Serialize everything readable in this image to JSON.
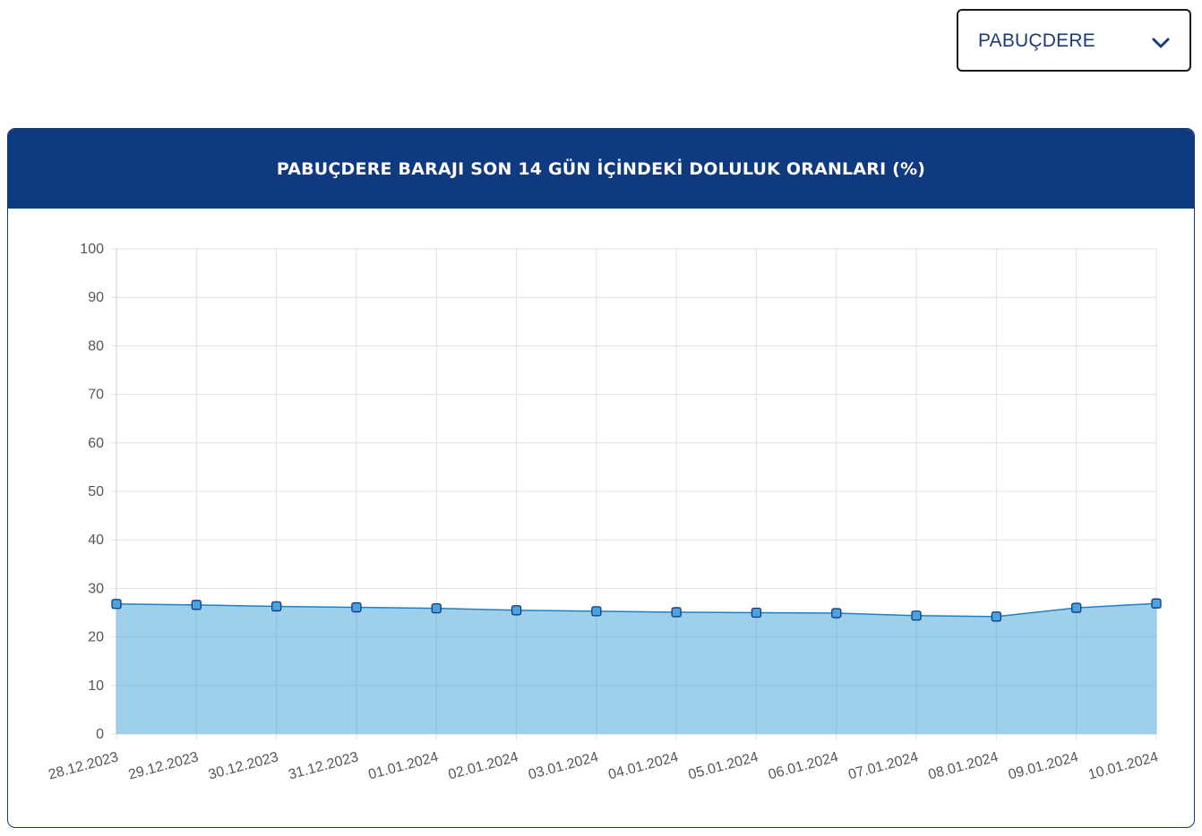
{
  "dropdown": {
    "selected": "PABUÇDERE",
    "icon": "chevron-down-icon"
  },
  "colors": {
    "header": "#0f3a80",
    "fill": "#99cdeb",
    "line": "#1f80c8",
    "marker": "#4aa3df",
    "marker_border": "#0f3a80",
    "grid": "#e0e0e0"
  },
  "chart_data": {
    "type": "area",
    "title": "PABUÇDERE BARAJI SON 14 GÜN İÇİNDEKİ DOLULUK ORANLARI (%)",
    "xlabel": "",
    "ylabel": "",
    "ylim": [
      0,
      100
    ],
    "yticks": [
      "0",
      "10",
      "20",
      "30",
      "40",
      "50",
      "60",
      "70",
      "80",
      "90",
      "100"
    ],
    "grid": true,
    "legend": "none",
    "categories": [
      "28.12.2023",
      "29.12.2023",
      "30.12.2023",
      "31.12.2023",
      "01.01.2024",
      "02.01.2024",
      "03.01.2024",
      "04.01.2024",
      "05.01.2024",
      "06.01.2024",
      "07.01.2024",
      "08.01.2024",
      "09.01.2024",
      "10.01.2024"
    ],
    "series": [
      {
        "values": [
          26.8,
          26.6,
          26.3,
          26.1,
          25.9,
          25.5,
          25.3,
          25.1,
          25.0,
          24.9,
          24.4,
          24.2,
          26.0,
          26.9
        ]
      }
    ]
  }
}
